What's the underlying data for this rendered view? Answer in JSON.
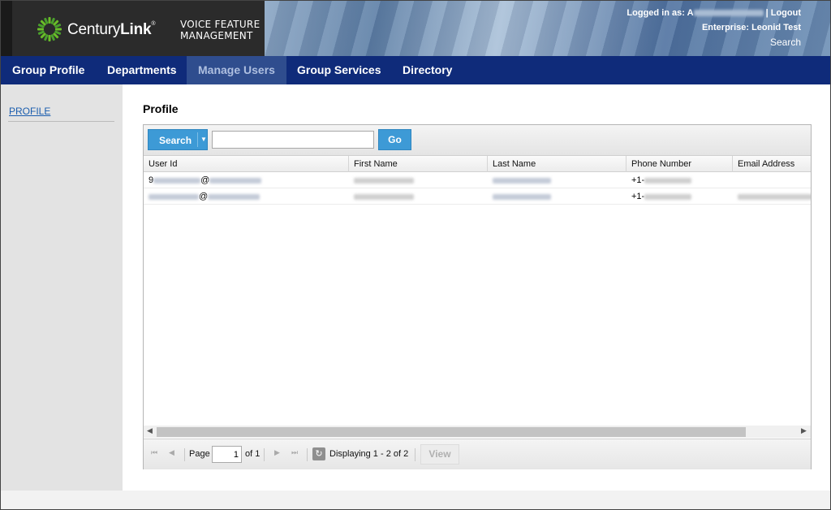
{
  "header": {
    "brand_name_regular": "Century",
    "brand_name_bold": "Link",
    "brand_mark": "®",
    "product_line1": "VOICE FEATURE",
    "product_line2": "MANAGEMENT",
    "logged_in_label": "Logged in as:",
    "logged_in_user_partial": "A",
    "logout_label": "| Logout",
    "enterprise_label": "Enterprise: Leonid Test",
    "search_label": "Search"
  },
  "nav": {
    "items": [
      {
        "label": "Group Profile",
        "active": false
      },
      {
        "label": "Departments",
        "active": false
      },
      {
        "label": "Manage Users",
        "active": true
      },
      {
        "label": "Group Services",
        "active": false
      },
      {
        "label": "Directory",
        "active": false
      }
    ]
  },
  "sidebar": {
    "items": [
      {
        "label": "PROFILE"
      }
    ]
  },
  "main": {
    "title": "Profile",
    "toolbar": {
      "search_button": "Search",
      "search_value": "",
      "go_button": "Go"
    },
    "table": {
      "columns": [
        "User Id",
        "First Name",
        "Last Name",
        "Phone Number",
        "Email Address"
      ],
      "rows": [
        {
          "user_id_prefix": "9",
          "user_id_at": "@",
          "phone_prefix": "+1-"
        },
        {
          "user_id_prefix": "",
          "user_id_at": "@",
          "phone_prefix": "+1-"
        }
      ]
    },
    "pager": {
      "page_label": "Page",
      "page_value": "1",
      "of_label": "of 1",
      "display_text": "Displaying 1 - 2 of 2",
      "view_button": "View"
    }
  },
  "colors": {
    "nav_background": "#0f2b7a",
    "nav_active": "#2f4d8e",
    "button_blue": "#3d9ad6",
    "sidebar_background": "#e3e3e3",
    "link": "#1a5dae"
  },
  "icons": {
    "logo": "centurylink-burst-icon",
    "search_dropdown": "caret-down-icon",
    "first_page": "first-page-icon",
    "prev_page": "prev-page-icon",
    "next_page": "next-page-icon",
    "last_page": "last-page-icon",
    "refresh": "refresh-icon"
  }
}
